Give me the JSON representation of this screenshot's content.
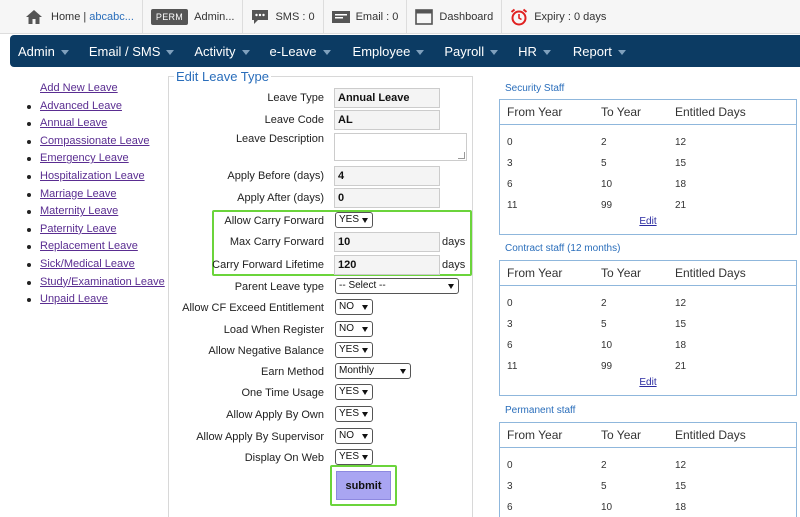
{
  "topbar": {
    "home_label": "Home |",
    "home_user": "abcabc...",
    "perm_badge": "PERM",
    "admin_label": "Admin...",
    "sms_label": "SMS : 0",
    "email_label": "Email : 0",
    "dashboard_label": "Dashboard",
    "expiry_label": "Expiry : 0 days"
  },
  "nav": [
    "Admin",
    "Email / SMS",
    "Activity",
    "e-Leave",
    "Employee",
    "Payroll",
    "HR",
    "Report"
  ],
  "sidebar": {
    "items": [
      "Add New Leave",
      "Advanced Leave",
      "Annual Leave",
      "Compassionate Leave",
      "Emergency Leave",
      "Hospitalization Leave",
      "Marriage Leave",
      "Maternity Leave",
      "Paternity Leave",
      "Replacement Leave",
      "Sick/Medical Leave",
      "Study/Examination Leave",
      "Unpaid Leave"
    ]
  },
  "form": {
    "title": "Edit Leave Type",
    "leave_type_label": "Leave Type",
    "leave_type_value": "Annual Leave",
    "leave_code_label": "Leave Code",
    "leave_code_value": "AL",
    "leave_description_label": "Leave Description",
    "leave_description_value": "",
    "apply_before_label": "Apply Before (days)",
    "apply_before_value": "4",
    "apply_after_label": "Apply After (days)",
    "apply_after_value": "0",
    "allow_carry_forward_label": "Allow Carry Forward",
    "allow_carry_forward_value": "YES",
    "max_carry_forward_label": "Max Carry Forward",
    "max_carry_forward_value": "10",
    "max_carry_forward_unit": "days",
    "carry_forward_lifetime_label": "Carry Forward Lifetime",
    "carry_forward_lifetime_value": "120",
    "carry_forward_lifetime_unit": "days",
    "parent_leave_type_label": "Parent Leave type",
    "parent_leave_type_value": "-- Select --",
    "allow_cf_exceed_label": "Allow CF Exceed Entitlement",
    "allow_cf_exceed_value": "NO",
    "load_when_register_label": "Load When Register",
    "load_when_register_value": "NO",
    "allow_negative_balance_label": "Allow Negative Balance",
    "allow_negative_balance_value": "YES",
    "earn_method_label": "Earn Method",
    "earn_method_value": "Monthly",
    "one_time_usage_label": "One Time Usage",
    "one_time_usage_value": "YES",
    "allow_apply_by_own_label": "Allow Apply By Own",
    "allow_apply_by_own_value": "YES",
    "allow_apply_by_supervisor_label": "Allow Apply By Supervisor",
    "allow_apply_by_supervisor_value": "NO",
    "display_on_web_label": "Display On Web",
    "display_on_web_value": "YES",
    "submit_label": "submit"
  },
  "staff": {
    "col_from": "From Year",
    "col_to": "To Year",
    "col_days": "Entitled Days",
    "edit_label": "Edit",
    "security": {
      "title": "Security Staff",
      "rows": [
        [
          "0",
          "2",
          "12"
        ],
        [
          "3",
          "5",
          "15"
        ],
        [
          "6",
          "10",
          "18"
        ],
        [
          "11",
          "99",
          "21"
        ]
      ]
    },
    "contract": {
      "title": "Contract staff (12 months)",
      "rows": [
        [
          "0",
          "2",
          "12"
        ],
        [
          "3",
          "5",
          "15"
        ],
        [
          "6",
          "10",
          "18"
        ],
        [
          "11",
          "99",
          "21"
        ]
      ]
    },
    "permanent": {
      "title": "Permanent staff",
      "rows": [
        [
          "0",
          "2",
          "12"
        ],
        [
          "3",
          "5",
          "15"
        ],
        [
          "6",
          "10",
          "18"
        ]
      ]
    }
  },
  "colors": {
    "nav_bg": "#0c3b63",
    "highlight_green": "#6bd43b",
    "submit_bg": "#a9a5f2",
    "link_blue": "#2a6ebb",
    "sidebar_link": "#5a2d91"
  }
}
